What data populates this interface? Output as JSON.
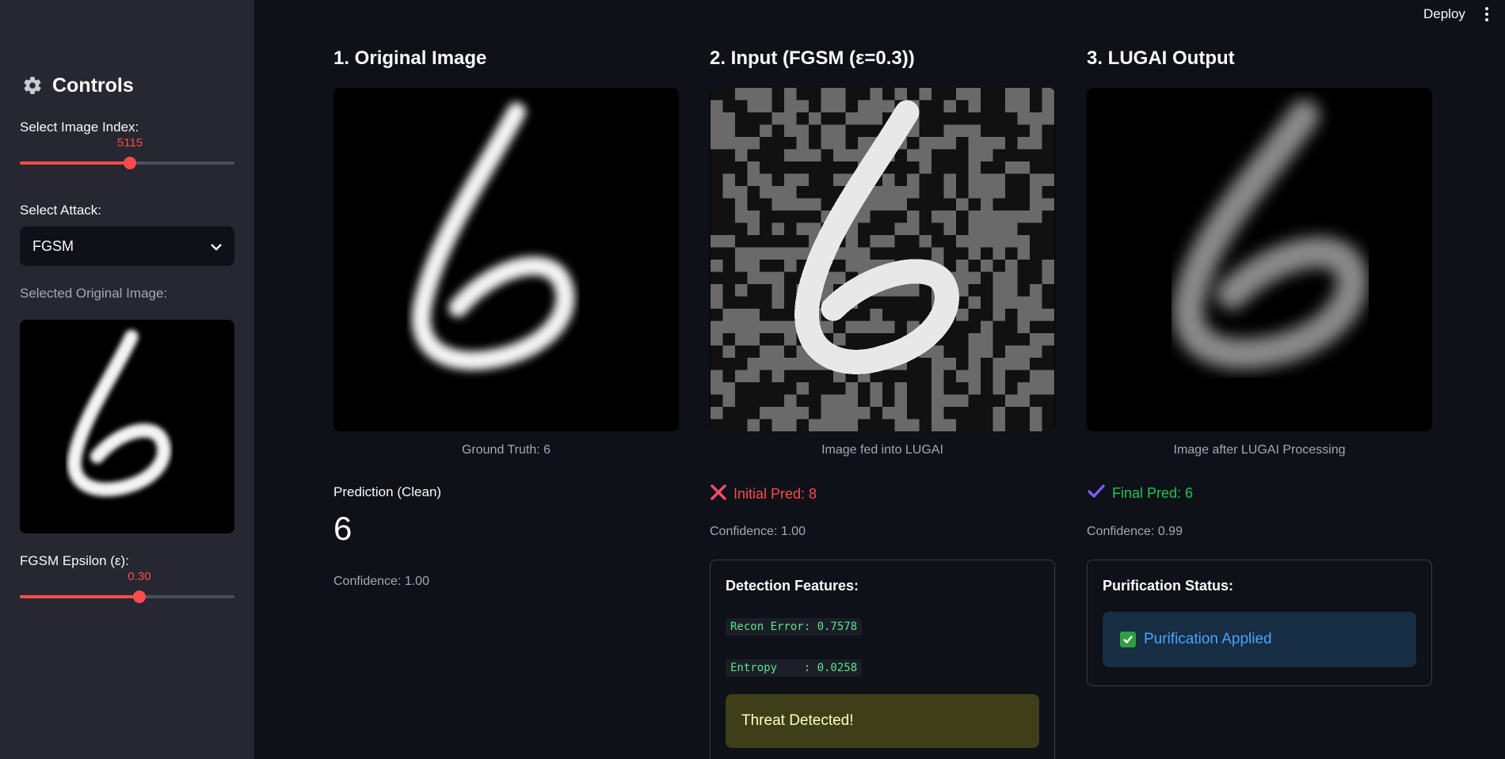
{
  "app": {
    "deploy_label": "Deploy",
    "menu_icon": "vertical-ellipsis-icon"
  },
  "sidebar": {
    "title": "Controls",
    "title_icon": "gear-icon",
    "image_index": {
      "label": "Select Image Index:",
      "value": "5115",
      "fraction": 0.51
    },
    "attack": {
      "label": "Select Attack:",
      "selected": "FGSM"
    },
    "original_label": "Selected Original Image:",
    "epsilon": {
      "label": "FGSM Epsilon (ε):",
      "value": "0.30",
      "fraction": 0.56
    }
  },
  "columns": {
    "original": {
      "title": "1. Original Image",
      "caption": "Ground Truth: 6",
      "prediction_label": "Prediction (Clean)",
      "prediction_value": "6",
      "confidence": "Confidence: 1.00"
    },
    "input": {
      "title": "2. Input (FGSM (ε=0.3))",
      "caption": "Image fed into LUGAI",
      "status": "Initial Pred: 8",
      "status_icon": "cross-icon",
      "confidence": "Confidence: 1.00",
      "detection": {
        "title": "Detection Features:",
        "recon": "Recon Error: 0.7578",
        "entropy": "Entropy    : 0.0258",
        "alert": "Threat Detected!"
      }
    },
    "output": {
      "title": "3. LUGAI Output",
      "caption": "Image after LUGAI Processing",
      "status": "Final Pred: 6",
      "status_icon": "check-icon",
      "confidence": "Confidence: 0.99",
      "purification": {
        "title": "Purification Status:",
        "alert": "Purification Applied"
      }
    }
  },
  "colors": {
    "accent": "#ff4b4b",
    "success": "#21c354",
    "error": "#ff4b4b",
    "info": "#4ba3ff"
  }
}
